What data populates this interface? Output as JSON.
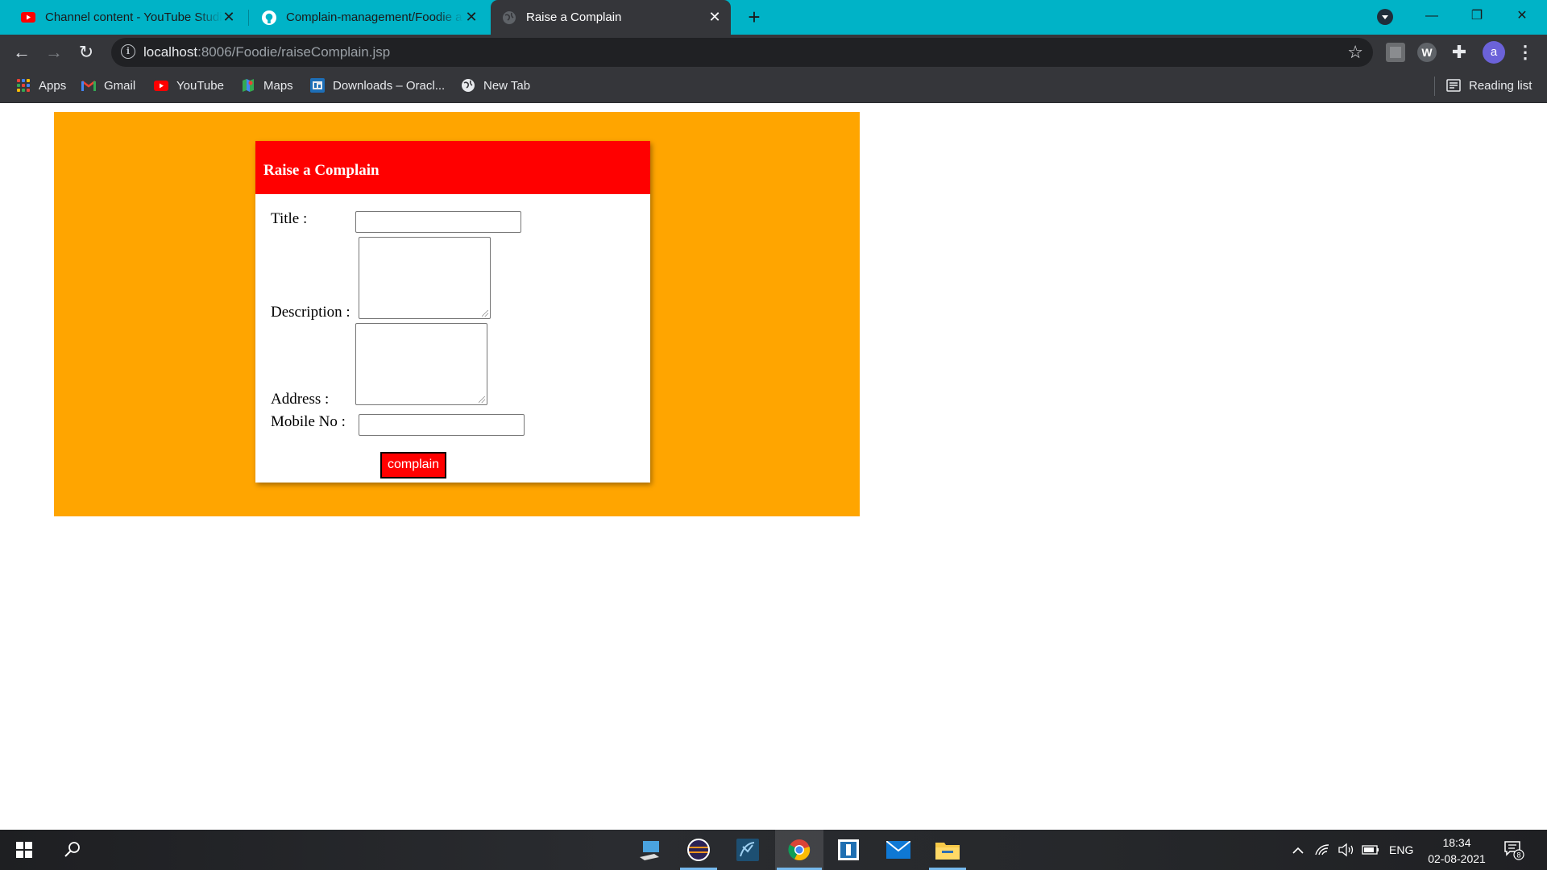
{
  "browser": {
    "tabs": [
      {
        "title": "Channel content - YouTube Studio",
        "favicon": "youtube-icon"
      },
      {
        "title": "Complain-management/Foodie at main",
        "favicon": "github-icon"
      },
      {
        "title": "Raise a Complain",
        "favicon": "globe-icon",
        "active": true
      }
    ],
    "address": {
      "host": "localhost",
      "path": ":8006/Foodie/raiseComplain.jsp"
    },
    "profile_initial": "a",
    "extension_w": "W",
    "bookmarks": [
      {
        "label": "Apps",
        "icon": "apps-grid-icon"
      },
      {
        "label": "Gmail",
        "icon": "gmail-icon"
      },
      {
        "label": "YouTube",
        "icon": "youtube-icon"
      },
      {
        "label": "Maps",
        "icon": "maps-icon"
      },
      {
        "label": "Downloads – Oracl...",
        "icon": "oracle-icon"
      },
      {
        "label": "New Tab",
        "icon": "globe-icon"
      }
    ],
    "reading_list": "Reading list"
  },
  "page": {
    "form_title": "Raise a Complain",
    "fields": {
      "title_label": "Title :",
      "title_value": "",
      "description_label": "Description :",
      "description_value": "",
      "address_label": "Address :",
      "address_value": "",
      "mobile_label": "Mobile No :",
      "mobile_value": ""
    },
    "submit_label": "complain"
  },
  "taskbar": {
    "language": "ENG",
    "time": "18:34",
    "date": "02-08-2021",
    "notification_count": "8"
  },
  "colors": {
    "tab_strip": "#00b3c7",
    "panel_background": "#ffa500",
    "form_header": "#ff0000",
    "submit_button": "#ff0000"
  }
}
